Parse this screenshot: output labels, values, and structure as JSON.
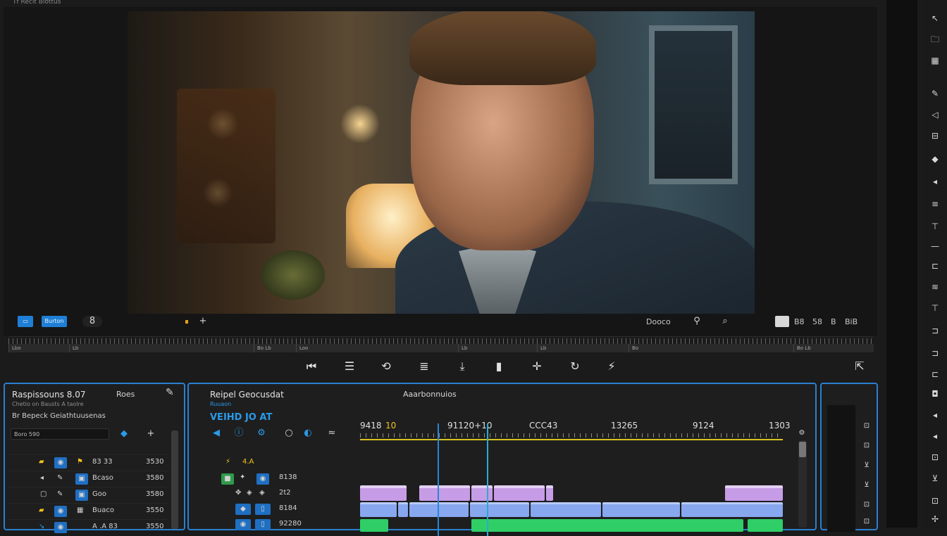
{
  "app": {
    "title": "Tf Recit Biottus"
  },
  "viewer": {
    "left_btn": "",
    "blue_btn": "Burton",
    "icon_a": "8",
    "icon_b": "+",
    "mode_label": "Dooco",
    "right_group": [
      "B8",
      "58",
      "B",
      "BiB"
    ]
  },
  "ruler": {
    "segments": [
      "Lbo",
      "Lb",
      "Bo Lb",
      "Loo",
      "Lb",
      "Lb",
      "Bo",
      "Bo Lb"
    ]
  },
  "left_panel": {
    "title": "Raspissouns  8.07",
    "subtitle": "Chetio on Bausts  A taolre",
    "label": "Br Bepeck  Geiathtuusenas",
    "tab": "Roes",
    "search_value": "Boro     590",
    "rows": [
      {
        "name": "83 33",
        "value": "3530"
      },
      {
        "name": "Bcaso",
        "value": "3580"
      },
      {
        "name": "Goo",
        "value": "3580"
      },
      {
        "name": "Buaco",
        "value": "3550"
      },
      {
        "name": "A .A 83",
        "value": "3550"
      }
    ]
  },
  "mid_panel": {
    "title": "Reipel Geocusdat",
    "subtitle": "Ruuaon",
    "tracks_label": "VEIHD JO AT",
    "tab": "Aaarbonnuios",
    "timecodes": [
      "9418",
      "10",
      "91120+10",
      "CCC43",
      "13265",
      "9124",
      "1303"
    ],
    "tracks": [
      {
        "name": "4.A",
        "label": ""
      },
      {
        "name": "8138",
        "label": ""
      },
      {
        "name": "2t2",
        "label": ""
      },
      {
        "name": "8184",
        "label": ""
      },
      {
        "name": "92280",
        "label": ""
      }
    ]
  },
  "colors": {
    "accent": "#1f7fd6",
    "panel_border": "#2a80d0",
    "playhead": "#2b86d6",
    "clip_purple": "#c79ce6",
    "clip_blue": "#87a7ef",
    "clip_green": "#2fce67",
    "timeline_marker": "#d8c320"
  }
}
